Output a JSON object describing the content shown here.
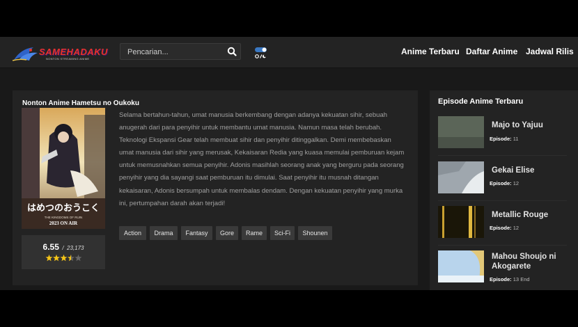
{
  "header": {
    "logo_text": "SAMEHADAKU",
    "logo_subtitle": "NONTON STREAMING ANIME",
    "search_placeholder": "Pencarian...",
    "nav": [
      {
        "label": "Anime Terbaru"
      },
      {
        "label": "Daftar Anime"
      },
      {
        "label": "Jadwal Rilis"
      }
    ]
  },
  "main": {
    "title": "Nonton Anime Hametsu no Oukoku",
    "poster": {
      "title_text": "はめつのおうこく",
      "subtitle_text": "THE KINGDOMS OF RUIN",
      "air_text": "2023 ON AIR"
    },
    "rating": {
      "score": "6.55",
      "separator": "/",
      "count": "23,173",
      "stars": 3.5
    },
    "synopsis": "Selama bertahun-tahun, umat manusia berkembang dengan adanya kekuatan sihir, sebuah anugerah dari para penyihir untuk membantu umat manusia. Namun masa telah berubah. Teknologi Ekspansi Gear telah membuat sihir dan penyihir ditinggalkan. Demi membebaskan umat manusia dari sihir yang merusak, Kekaisaran Redia yang kuasa memulai pemburuan kejam untuk memusnahkan semua penyihir. Adonis masihlah seorang anak yang berguru pada seorang penyihir yang dia sayangi saat pemburuan itu dimulai. Saat penyihir itu musnah ditangan kekaisaran, Adonis bersumpah untuk membalas dendam. Dengan kekuatan penyihir yang murka ini, pertumpahan darah akan terjadi!",
    "genres": [
      "Action",
      "Drama",
      "Fantasy",
      "Gore",
      "Rame",
      "Sci-Fi",
      "Shounen"
    ]
  },
  "sidebar": {
    "title": "Episode Anime Terbaru",
    "episode_label": "Episode:",
    "items": [
      {
        "title": "Majo to Yajuu",
        "episode": "11"
      },
      {
        "title": "Gekai Elise",
        "episode": "12"
      },
      {
        "title": "Metallic Rouge",
        "episode": "12"
      },
      {
        "title": "Mahou Shoujo ni Akogarete",
        "episode": "13 End"
      }
    ]
  },
  "colors": {
    "background": "#191919",
    "panel": "#232323",
    "tag": "#3a3a3a",
    "star": "#f5c518",
    "logo_red": "#e8322a"
  }
}
